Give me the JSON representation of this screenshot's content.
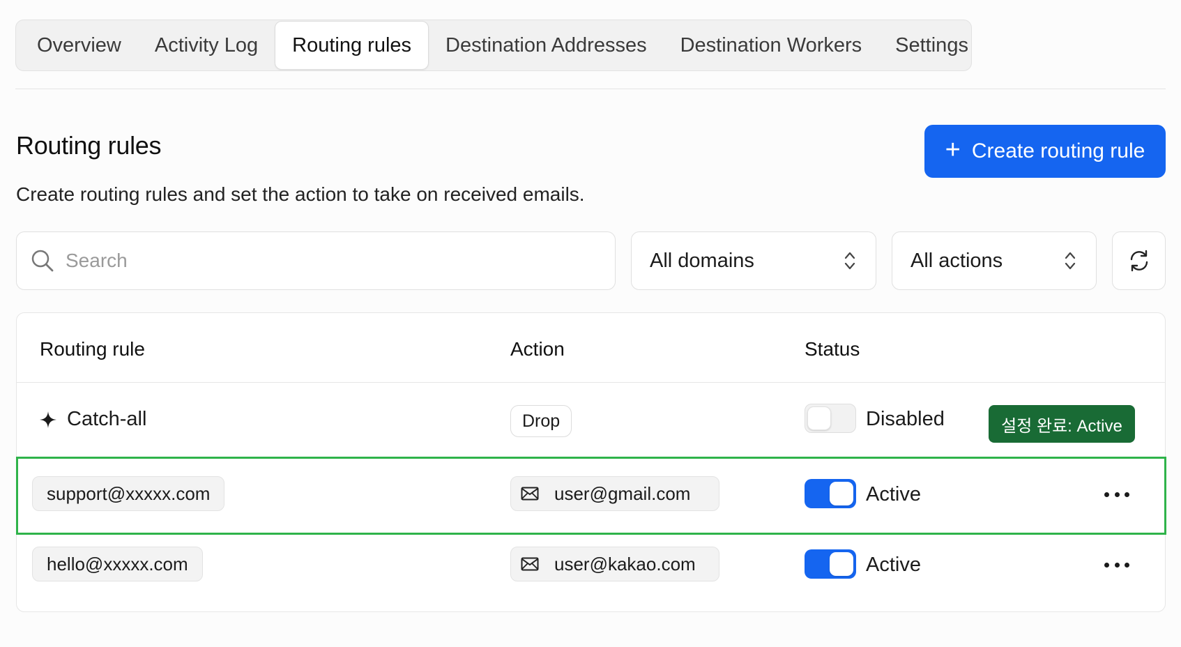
{
  "tabs": [
    {
      "label": "Overview",
      "active": false
    },
    {
      "label": "Activity Log",
      "active": false
    },
    {
      "label": "Routing rules",
      "active": true
    },
    {
      "label": "Destination Addresses",
      "active": false
    },
    {
      "label": "Destination Workers",
      "active": false
    },
    {
      "label": "Settings",
      "active": false
    }
  ],
  "header": {
    "title": "Routing rules",
    "description": "Create routing rules and set the action to take on received emails.",
    "create_button_label": "Create routing rule"
  },
  "filters": {
    "search_placeholder": "Search",
    "search_value": "",
    "domain_select": "All domains",
    "action_select": "All actions"
  },
  "table": {
    "columns": [
      "Routing rule",
      "Action",
      "Status"
    ],
    "rows": [
      {
        "rule": "Catch-all",
        "action": "Drop",
        "enabled": false,
        "status": "Disabled",
        "badge": "설정 완료: Active"
      },
      {
        "rule": "support@xxxxx.com",
        "action": "user@gmail.com",
        "enabled": true,
        "status": "Active",
        "highlighted": true
      },
      {
        "rule": "hello@xxxxx.com",
        "action": "user@kakao.com",
        "enabled": true,
        "status": "Active"
      }
    ]
  },
  "colors": {
    "accent": "#1565f0",
    "badge": "#196b35",
    "highlight": "#2fb34a"
  },
  "icons": [
    "search-icon",
    "chevron-updown-icon",
    "refresh-icon",
    "sparkle-icon",
    "mail-icon",
    "more-icon",
    "plus-icon"
  ]
}
